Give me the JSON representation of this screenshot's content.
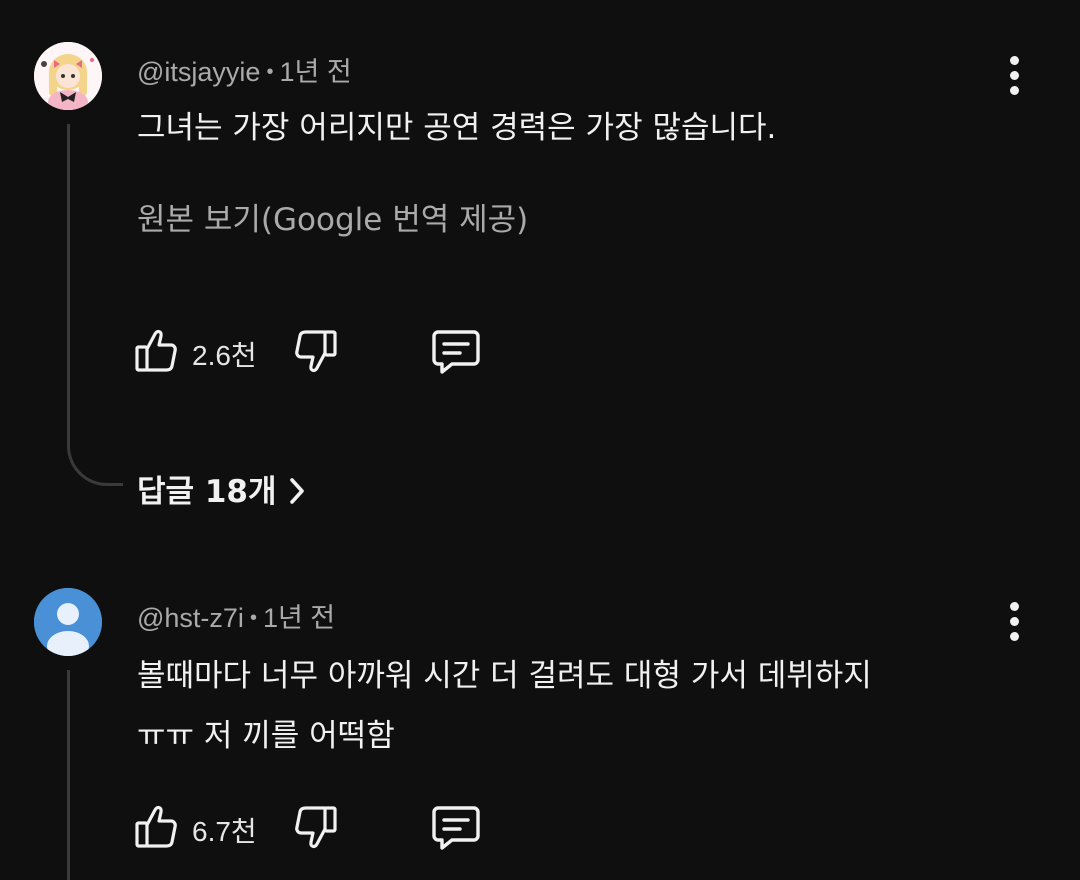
{
  "comments": [
    {
      "author": "@itsjayyie",
      "separator": "•",
      "time": "1년 전",
      "text": "그녀는 가장 어리지만 공연 경력은 가장 많습니다.",
      "translate_label": "원본 보기(Google 번역 제공)",
      "likes": "2.6천",
      "replies_label": "답글 18개",
      "avatar_icon": "cartoon-girl-avatar"
    },
    {
      "author": "@hst-z7i",
      "separator": "•",
      "time": "1년 전",
      "text_lines": [
        "볼때마다 너무 아까워 시간 더 걸려도 대형 가서 데뷔하지",
        "ㅠㅠ 저 끼를 어떡함"
      ],
      "likes": "6.7천",
      "avatar_icon": "default-user-avatar"
    }
  ],
  "icons": {
    "like": "thumbs-up-icon",
    "dislike": "thumbs-down-icon",
    "reply": "comment-icon",
    "more": "more-vertical-icon",
    "chevron": "chevron-right-icon"
  },
  "colors": {
    "background": "#0f0f0f",
    "text": "#f1f1f1",
    "secondary_text": "#aaaaaa",
    "thread_line": "#3a3a3a",
    "default_avatar": "#4a90d6"
  }
}
